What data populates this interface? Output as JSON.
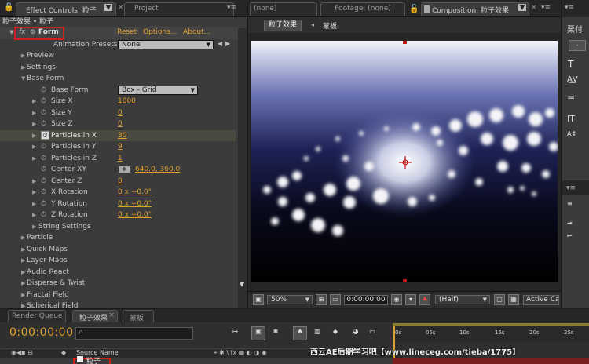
{
  "effect_controls": {
    "tab_label": "Effect Controls: 粒子",
    "project_tab": "Project",
    "breadcrumb": "粒子效果 • 粒子",
    "effect": {
      "fx": "fx",
      "name": "Form",
      "reset": "Reset",
      "options": "Options...",
      "about": "About..."
    },
    "animation_presets_label": "Animation Presets:",
    "animation_presets_value": "None",
    "rows": [
      {
        "label": "Preview"
      },
      {
        "label": "Settings"
      },
      {
        "label": "Base Form"
      },
      {
        "label": "Base Form",
        "value": "Box - Grid"
      },
      {
        "label": "Size X",
        "value": "1000"
      },
      {
        "label": "Size Y",
        "value": "0"
      },
      {
        "label": "Size Z",
        "value": "0"
      },
      {
        "label": "Particles in X",
        "value": "30"
      },
      {
        "label": "Particles in Y",
        "value": "9"
      },
      {
        "label": "Particles in Z",
        "value": "1"
      },
      {
        "label": "Center XY",
        "value": "640.0, 360.0"
      },
      {
        "label": "Center Z",
        "value": "0"
      },
      {
        "label": "X Rotation",
        "value": "0 x +0.0°"
      },
      {
        "label": "Y Rotation",
        "value": "0 x +0.0°"
      },
      {
        "label": "Z Rotation",
        "value": "0 x +0.0°"
      },
      {
        "label": "String Settings"
      },
      {
        "label": "Particle"
      },
      {
        "label": "Quick Maps"
      },
      {
        "label": "Layer Maps"
      },
      {
        "label": "Audio React"
      },
      {
        "label": "Disperse & Twist"
      },
      {
        "label": "Fractal Field"
      },
      {
        "label": "Spherical Field"
      }
    ]
  },
  "composition": {
    "tab_none": "(none)",
    "tab_footage": "Footage: (none)",
    "tab_comp": "Composition: 粒子效果",
    "crumb": "粒子效果",
    "crumb2": "蒙板",
    "zoom": "50%",
    "timecode": "0:00:00:00",
    "resolution": "(Half)",
    "camera": "Active Car"
  },
  "right_panel": {
    "label": "粟付"
  },
  "timeline": {
    "tab_render": "Render Queue",
    "tab_comp": "粒子效果",
    "tab_mask": "蒙板",
    "timecode": "0:00:00:00",
    "search_placeholder": "",
    "col_source": "Source Name",
    "layer_name": "粒子",
    "ruler": [
      "0s",
      "05s",
      "10s",
      "15s",
      "20s",
      "25s"
    ],
    "watermark": "西云AE后期学习吧【www.lineceg.com/tieba/1775】"
  },
  "colors": {
    "accent": "#e0a030",
    "highlight_box": "#cc2020",
    "selected_tab": "#3c3c3c"
  }
}
